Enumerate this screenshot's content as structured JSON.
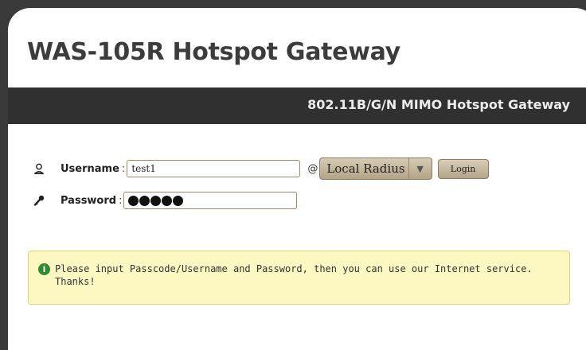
{
  "header": {
    "title": "WAS-105R Hotspot Gateway"
  },
  "banner": {
    "subtitle": "802.11B/G/N MIMO Hotspot Gateway"
  },
  "login_form": {
    "username_label": "Username",
    "username_value": "test1",
    "username_icon": "user-icon",
    "password_label": "Password",
    "password_masked_count": 5,
    "password_icon": "key-icon",
    "separator_colon": ":",
    "at_symbol": "@",
    "realm_select": {
      "selected": "Local Radius",
      "arrow": "▼"
    },
    "login_button": "Login"
  },
  "notice": {
    "icon": "info-icon",
    "icon_glyph": "i",
    "message": "Please input Passcode/Username and Password, then you can use our Internet service. Thanks!"
  },
  "colors": {
    "background": "#3a3a3a",
    "banner": "#303030",
    "notice_bg": "#fdf7c2",
    "notice_border": "#e3d36b",
    "button": "#c4b79c"
  }
}
